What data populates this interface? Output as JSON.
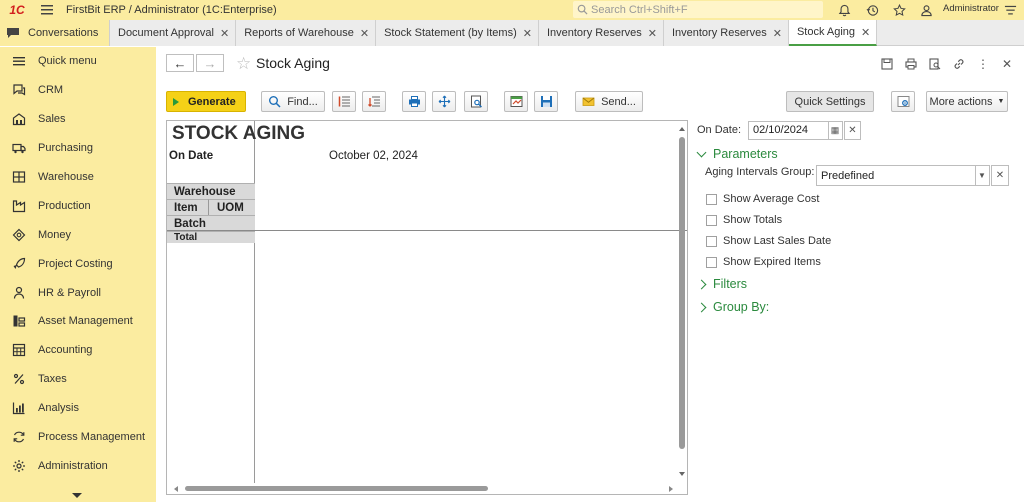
{
  "titlebar": {
    "logo": "1C",
    "title": "FirstBit ERP / Administrator  (1C:Enterprise)",
    "search_placeholder": "Search Ctrl+Shift+F",
    "username": "Administrator"
  },
  "tabs": [
    {
      "label": "Conversations"
    },
    {
      "label": "Document Approval"
    },
    {
      "label": "Reports of Warehouse"
    },
    {
      "label": "Stock Statement (by Items)"
    },
    {
      "label": "Inventory Reserves"
    },
    {
      "label": "Inventory Reserves"
    },
    {
      "label": "Stock Aging"
    }
  ],
  "sidebar": {
    "items": [
      {
        "label": "Quick menu",
        "icon": "menu-icon"
      },
      {
        "label": "CRM",
        "icon": "crm-icon"
      },
      {
        "label": "Sales",
        "icon": "sales-icon"
      },
      {
        "label": "Purchasing",
        "icon": "truck-icon"
      },
      {
        "label": "Warehouse",
        "icon": "warehouse-icon"
      },
      {
        "label": "Production",
        "icon": "factory-icon"
      },
      {
        "label": "Money",
        "icon": "money-icon"
      },
      {
        "label": "Project Costing",
        "icon": "rocket-icon"
      },
      {
        "label": "HR & Payroll",
        "icon": "person-icon"
      },
      {
        "label": "Asset Management",
        "icon": "asset-icon"
      },
      {
        "label": "Accounting",
        "icon": "calculator-icon"
      },
      {
        "label": "Taxes",
        "icon": "percent-icon"
      },
      {
        "label": "Analysis",
        "icon": "chart-icon"
      },
      {
        "label": "Process Management",
        "icon": "process-icon"
      },
      {
        "label": "Administration",
        "icon": "gear-icon"
      }
    ]
  },
  "page": {
    "title": "Stock Aging"
  },
  "toolbar": {
    "generate": "Generate",
    "find": "Find...",
    "send": "Send...",
    "quick_settings": "Quick Settings",
    "more_actions": "More actions"
  },
  "report": {
    "title": "STOCK AGING",
    "on_date_label": "On Date",
    "on_date_value": "October 02, 2024",
    "hdr_warehouse": "Warehouse",
    "hdr_item": "Item",
    "hdr_uom": "UOM",
    "hdr_batch": "Batch",
    "hdr_total": "Total"
  },
  "settings": {
    "on_date_label": "On Date:",
    "on_date_value": "02/10/2024",
    "parameters": "Parameters",
    "aging_label": "Aging Intervals Group:",
    "aging_value": "Predefined",
    "checkboxes": [
      {
        "label": "Show Average Cost",
        "checked": false
      },
      {
        "label": "Show Totals",
        "checked": false
      },
      {
        "label": "Show Last Sales Date",
        "checked": false
      },
      {
        "label": "Show Expired Items",
        "checked": false
      }
    ],
    "filters": "Filters",
    "group_by": "Group By:"
  },
  "colors": {
    "accent_yellow": "#fbeca0",
    "generate_yellow": "#f5d117",
    "group_green": "#2b8a3e",
    "logo_red": "#d21e1e"
  }
}
